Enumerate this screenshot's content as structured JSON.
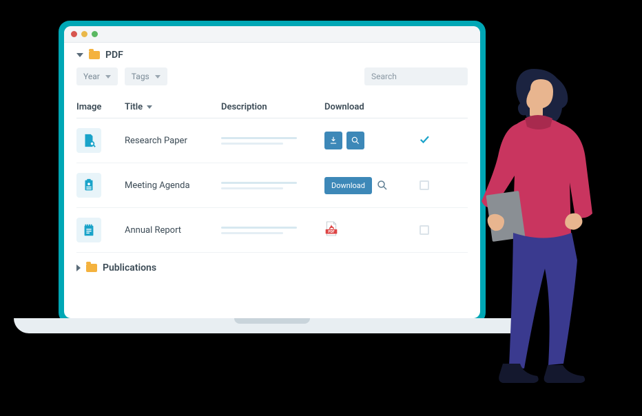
{
  "folders": {
    "open": {
      "name": "PDF"
    },
    "closed": {
      "name": "Publications"
    }
  },
  "filters": {
    "year": "Year",
    "tags": "Tags",
    "search_placeholder": "Search"
  },
  "columns": {
    "image": "Image",
    "title": "Title",
    "description": "Description",
    "download": "Download"
  },
  "rows": [
    {
      "title": "Research Paper",
      "download_style": "icons",
      "checked": true
    },
    {
      "title": "Meeting Agenda",
      "download_style": "button",
      "download_label": "Download",
      "checked": false
    },
    {
      "title": "Annual Report",
      "download_style": "pdf",
      "checked": false
    }
  ]
}
